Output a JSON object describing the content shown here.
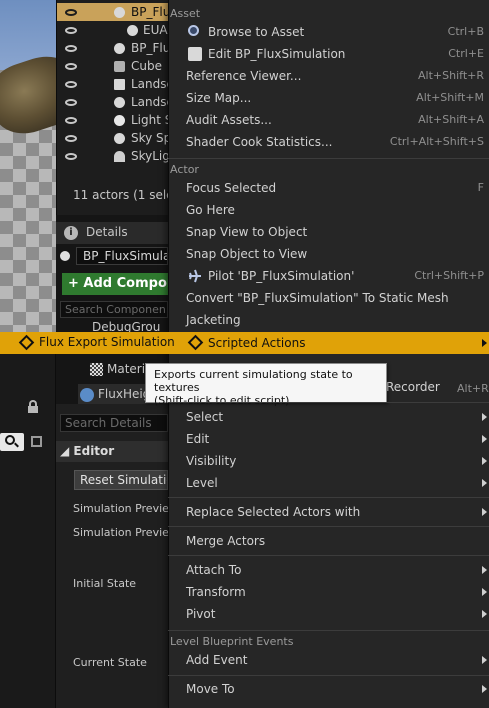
{
  "outliner": {
    "rows": [
      {
        "name": "BP_Flu",
        "selected": true
      },
      {
        "name": "EUA",
        "selected": false
      },
      {
        "name": "BP_Flu",
        "selected": false
      },
      {
        "name": "Cube",
        "selected": false
      },
      {
        "name": "Landsc",
        "selected": false
      },
      {
        "name": "Landsc",
        "selected": false
      },
      {
        "name": "Light S",
        "selected": false
      },
      {
        "name": "Sky Sp",
        "selected": false
      },
      {
        "name": "SkyLig",
        "selected": false
      }
    ],
    "actor_count": "11 actors (1 selec"
  },
  "details": {
    "tab_label": "Details",
    "actor_name": "BP_FluxSimula",
    "add_component_label": "+ Add Compon",
    "search_components_placeholder": "Search Componen",
    "debug_group": "DebugGrou",
    "material": "Materi",
    "flux_height": "FluxHeig",
    "search_details_placeholder": "Search Details",
    "editor_category": "Editor",
    "reset_simulation": "Reset Simulation",
    "properties": [
      "Simulation Preview",
      "Simulation Preview",
      "Initial State",
      "Current State"
    ]
  },
  "highlighted_item": {
    "label": "Flux Export Simulation"
  },
  "context_menu": {
    "sections": {
      "asset": "Asset",
      "actor": "Actor",
      "level_blueprint_events": "Level Blueprint Events"
    },
    "asset_items": [
      {
        "label": "Browse to Asset",
        "shortcut": "Ctrl+B",
        "icon": "browse-icon"
      },
      {
        "label": "Edit BP_FluxSimulation",
        "shortcut": "Ctrl+E",
        "icon": "edit-icon"
      },
      {
        "label": "Reference Viewer...",
        "shortcut": "Alt+Shift+R"
      },
      {
        "label": "Size Map...",
        "shortcut": "Alt+Shift+M"
      },
      {
        "label": "Audit Assets...",
        "shortcut": "Alt+Shift+A"
      },
      {
        "label": "Shader Cook Statistics...",
        "shortcut": "Ctrl+Alt+Shift+S"
      }
    ],
    "actor_items": [
      {
        "label": "Focus Selected",
        "shortcut": "F"
      },
      {
        "label": "Go Here",
        "shortcut": ""
      },
      {
        "label": "Snap View to Object",
        "shortcut": ""
      },
      {
        "label": "Snap Object to View",
        "shortcut": ""
      },
      {
        "label": "Pilot 'BP_FluxSimulation'",
        "shortcut": "Ctrl+Shift+P",
        "icon": "pilot-icon"
      },
      {
        "label": "Convert \"BP_FluxSimulation\" To Static Mesh",
        "shortcut": ""
      },
      {
        "label": "Jacketing",
        "shortcut": ""
      },
      {
        "label": "Scripted Actions",
        "shortcut": "",
        "submenu": true,
        "highlighted": true
      }
    ],
    "recorder_fragment": "Recorder",
    "recorder_shortcut": "Alt+R",
    "group1": [
      "Select",
      "Edit",
      "Visibility",
      "Level"
    ],
    "group2": [
      "Replace Selected Actors with"
    ],
    "group3": [
      "Merge Actors"
    ],
    "group4": [
      "Attach To",
      "Transform",
      "Pivot"
    ],
    "event_items": [
      "Add Event"
    ],
    "last_items": [
      "Move To"
    ]
  },
  "tooltip": {
    "text": "Exports current simulationg state to textures",
    "hint": "(Shift-click to edit script)"
  },
  "colors": {
    "menu_bg": "#262626",
    "highlight": "#e0a208",
    "add_component": "#2f7a2f"
  }
}
